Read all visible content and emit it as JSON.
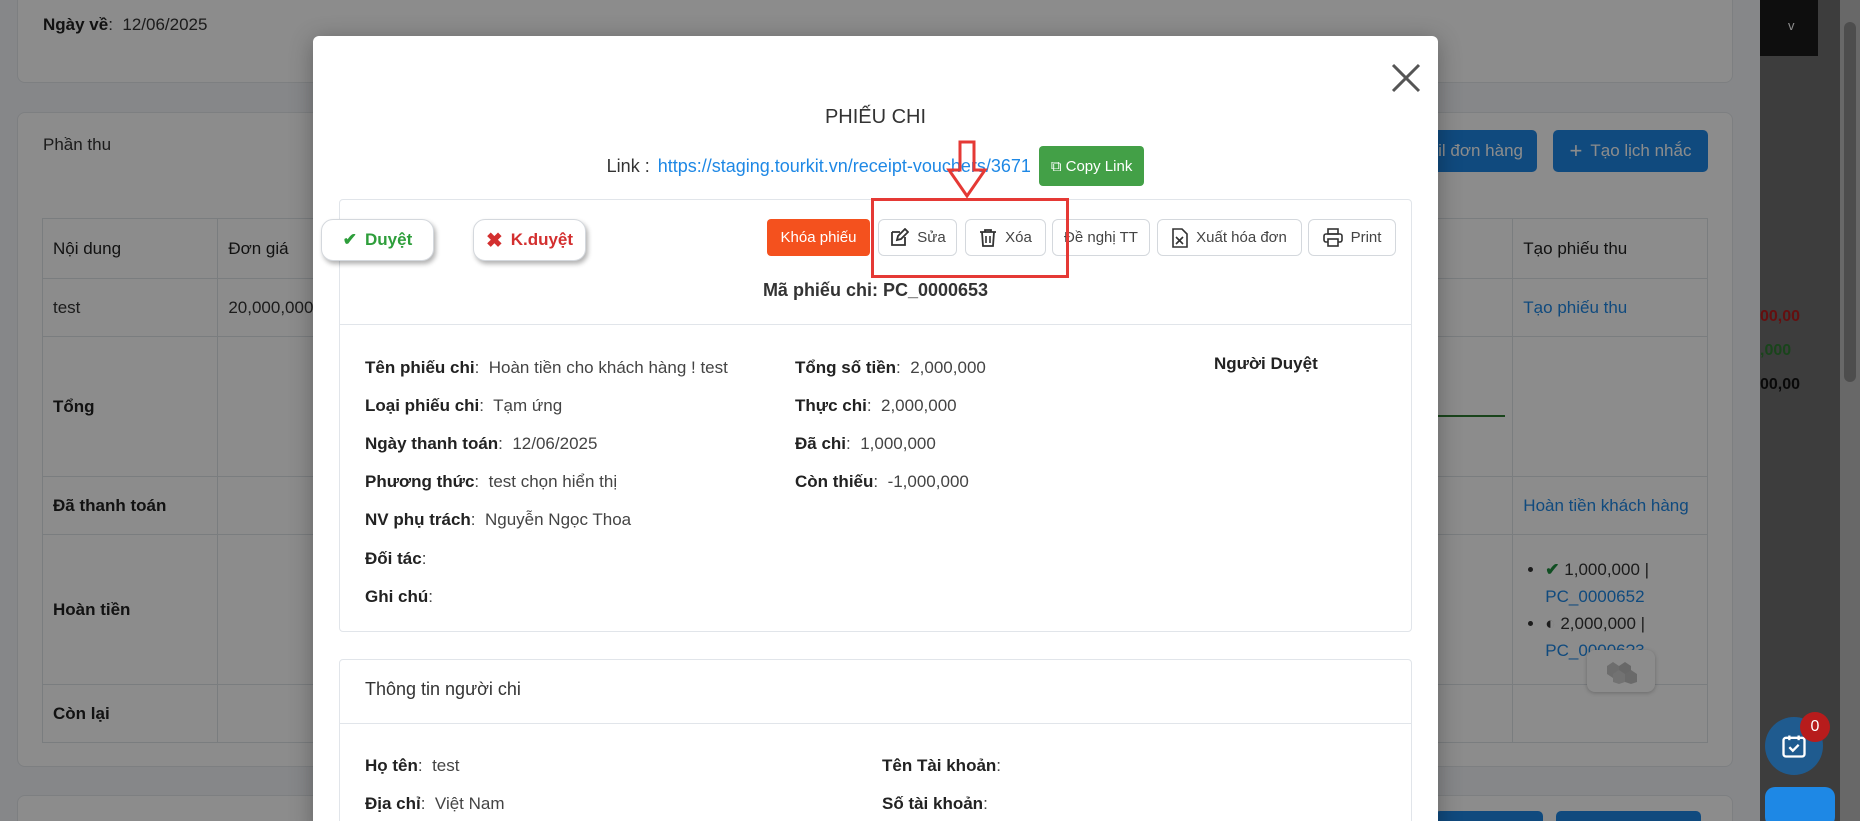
{
  "background": {
    "return_date_label": "Ngày về",
    "return_date_value": "12/06/2025",
    "section_title": "Phần thu",
    "order_button": "ail đơn hàng",
    "remind_button": "Tạo lịch nhắc",
    "table": {
      "headers": [
        "Nội dung",
        "Đơn giá",
        "Tạo phiếu thu"
      ],
      "row_test": {
        "label": "test",
        "price": "20,000,000",
        "action": "Tạo phiếu thu"
      },
      "row_total": "Tổng",
      "row_paid": {
        "label": "Đã thanh toán",
        "action": "Hoàn tiền khách hàng"
      },
      "row_refund": {
        "label": "Hoàn tiền",
        "items": [
          {
            "amount": "1,000,000 |",
            "code": "PC_0000652"
          },
          {
            "amount": "2,000,000 |",
            "code": "PC_00006?3"
          }
        ]
      },
      "row_remaining": "Còn lại"
    },
    "right_strip": {
      "top_text": "v",
      "values": [
        "00,00",
        ",000",
        "00,00"
      ]
    },
    "notification_count": "0"
  },
  "modal": {
    "title": "PHIẾU CHI",
    "link_label": "Link :",
    "link_url": "https://staging.tourkit.vn/receipt-vouchers/3671",
    "copy_link": "Copy Link",
    "actions": {
      "approve": "Duyệt",
      "reject": "K.duyệt",
      "lock": "Khóa phiếu",
      "edit": "Sửa",
      "delete": "Xóa",
      "propose": "Đề nghị TT",
      "invoice": "Xuất hóa đơn",
      "print": "Print"
    },
    "voucher_code": "Mã phiếu chi: PC_0000653",
    "details_left": [
      {
        "label": "Tên phiếu chi",
        "value": "Hoàn tiền cho khách hàng ! test"
      },
      {
        "label": "Loại phiếu chi",
        "value": "Tạm ứng"
      },
      {
        "label": "Ngày thanh toán",
        "value": "12/06/2025"
      },
      {
        "label": "Phương thức",
        "value": "test chọn hiển thị"
      },
      {
        "label": "NV phụ trách",
        "value": "Nguyễn Ngọc Thoa"
      },
      {
        "label": "Đối tác",
        "value": ""
      },
      {
        "label": "Ghi chú",
        "value": ""
      }
    ],
    "details_right": [
      {
        "label": "Tổng số tiền",
        "value": "2,000,000"
      },
      {
        "label": "Thực chi",
        "value": "2,000,000"
      },
      {
        "label": "Đã chi",
        "value": "1,000,000"
      },
      {
        "label": "Còn thiếu",
        "value": "-1,000,000"
      }
    ],
    "approver_label": "Người Duyệt",
    "payer": {
      "title": "Thông tin người chi",
      "name_label": "Họ tên",
      "name_value": "test",
      "address_label": "Địa chỉ",
      "address_value": "Việt Nam",
      "account_name_label": "Tên Tài khoản",
      "account_number_label": "Số tài khoản"
    }
  },
  "colors": {
    "primary": "#1e88e5",
    "success": "#43a047",
    "danger": "#d32f2f",
    "lock": "#f4511e",
    "highlight": "#e53935"
  }
}
